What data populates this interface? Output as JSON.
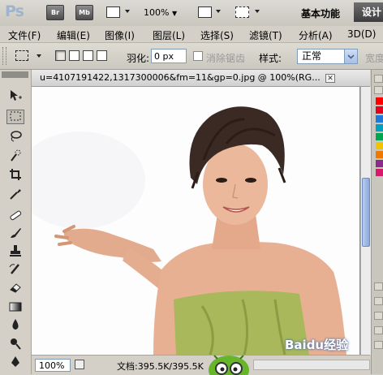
{
  "app": {
    "logo": "Ps",
    "bridge_label": "Br",
    "minibridge_label": "Mb",
    "zoom": "100%",
    "workspace_label": "基本功能",
    "workspace_button": "设计"
  },
  "menu": {
    "items": [
      "文件(F)",
      "编辑(E)",
      "图像(I)",
      "图层(L)",
      "选择(S)",
      "滤镜(T)",
      "分析(A)",
      "3D(D)"
    ]
  },
  "options": {
    "feather_label": "羽化:",
    "feather_value": "0 px",
    "antialias_label": "消除锯齿",
    "style_label": "样式:",
    "style_value": "正常",
    "width_label": "宽度"
  },
  "document": {
    "title": "u=4107191422,1317300006&fm=11&gp=0.jpg @ 100%(RG...",
    "zoom": "100%",
    "info": "文档:395.5K/395.5K"
  },
  "watermark": "Baidu经验",
  "colors": {
    "swatches": [
      "#ff0000",
      "#e8001f",
      "#1e7ad8",
      "#00a0c0",
      "#00a550",
      "#f2c400",
      "#ef7800",
      "#8b2a8b",
      "#d8186b"
    ]
  }
}
